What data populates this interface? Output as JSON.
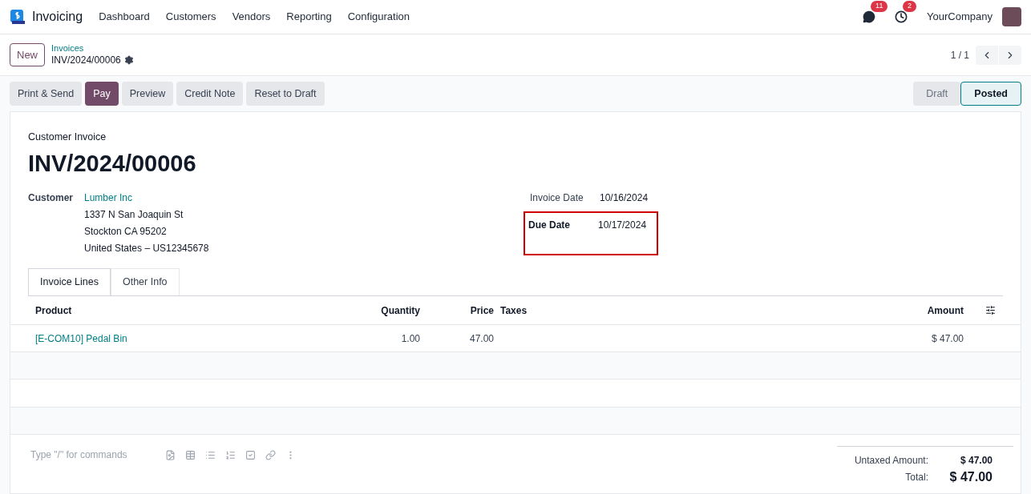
{
  "nav": {
    "app_name": "Invoicing",
    "menu": [
      "Dashboard",
      "Customers",
      "Vendors",
      "Reporting",
      "Configuration"
    ],
    "messages_badge": "11",
    "activities_badge": "2",
    "company": "YourCompany"
  },
  "control_panel": {
    "new_button": "New",
    "breadcrumb": "Invoices",
    "record": "INV/2024/00006",
    "pager": "1 / 1"
  },
  "actions": [
    {
      "label": "Print & Send",
      "kind": "secondary"
    },
    {
      "label": "Pay",
      "kind": "primary"
    },
    {
      "label": "Preview",
      "kind": "secondary"
    },
    {
      "label": "Credit Note",
      "kind": "secondary"
    },
    {
      "label": "Reset to Draft",
      "kind": "secondary"
    }
  ],
  "stages": [
    {
      "label": "Draft",
      "selected": false
    },
    {
      "label": "Posted",
      "selected": true
    }
  ],
  "invoice": {
    "type": "Customer Invoice",
    "number": "INV/2024/00006",
    "customer_label": "Customer",
    "customer": "Lumber Inc",
    "address": [
      "1337 N San Joaquin St",
      "Stockton CA 95202",
      "United States – US12345678"
    ],
    "dates": [
      {
        "label": "Invoice Date",
        "value": "10/16/2024",
        "highlighted": false,
        "bold": false
      },
      {
        "label": "Due Date",
        "value": "10/17/2024",
        "highlighted": true,
        "bold": true
      }
    ]
  },
  "tabs": [
    {
      "label": "Invoice Lines",
      "selected": true
    },
    {
      "label": "Other Info",
      "selected": false
    }
  ],
  "table": {
    "columns": [
      "Product",
      "Quantity",
      "Price",
      "Taxes",
      "Amount"
    ],
    "rows": [
      {
        "product": "[E-COM10] Pedal Bin",
        "quantity": "1.00",
        "price": "47.00",
        "amount": "$ 47.00"
      }
    ]
  },
  "notes": {
    "placeholder": "Type \"/\" for commands"
  },
  "totals": [
    {
      "label": "Untaxed Amount:",
      "value": "$ 47.00",
      "kind": "subtotal"
    },
    {
      "label": "Total:",
      "value": "$ 47.00",
      "kind": "total"
    }
  ]
}
